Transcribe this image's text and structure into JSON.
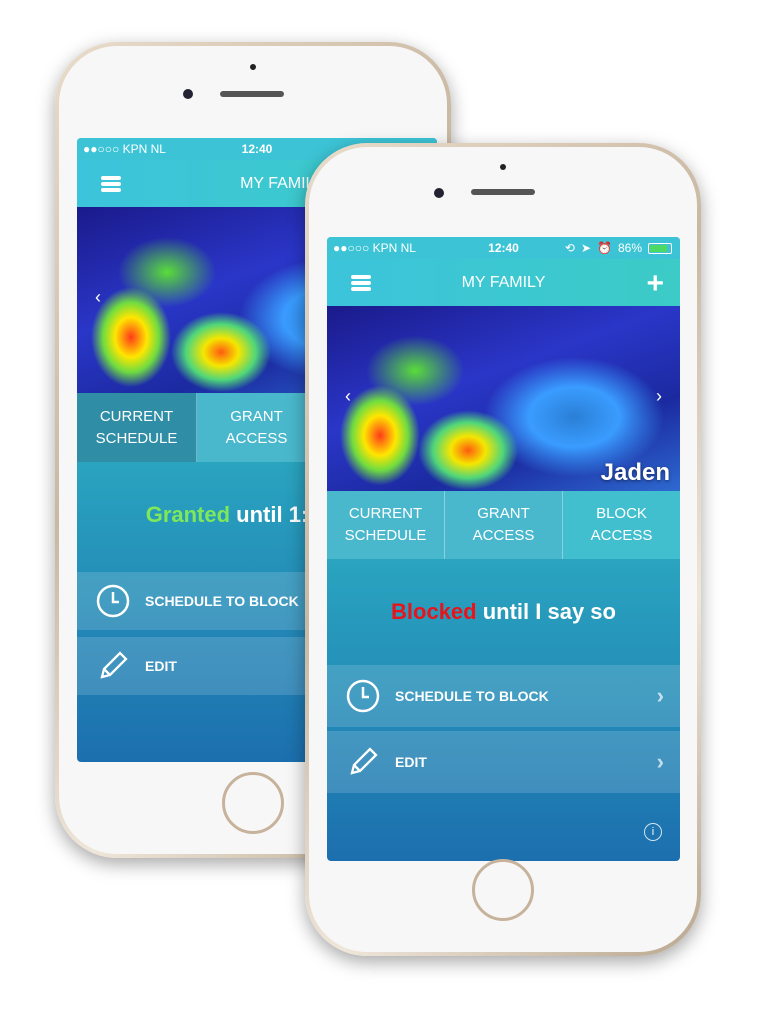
{
  "status_bar": {
    "carrier": "●●○○○ KPN NL",
    "time": "12:40",
    "battery": "86%"
  },
  "nav": {
    "title": "MY FAMILY"
  },
  "profile": {
    "name": "Jaden"
  },
  "tabs": [
    {
      "label": "CURRENT\nSCHEDULE"
    },
    {
      "label": "GRANT\nACCESS"
    },
    {
      "label": "BLOCK\nACCESS"
    }
  ],
  "back_phone": {
    "state_word": "Granted",
    "state_rest": " until 1:",
    "state_color": "#7fe85a"
  },
  "front_phone": {
    "state_word": "Blocked",
    "state_rest": " until I say so",
    "state_color": "#e8141c"
  },
  "rows": [
    {
      "label": "SCHEDULE TO BLOCK",
      "icon": "clock-icon"
    },
    {
      "label": "EDIT",
      "icon": "pencil-icon"
    }
  ]
}
